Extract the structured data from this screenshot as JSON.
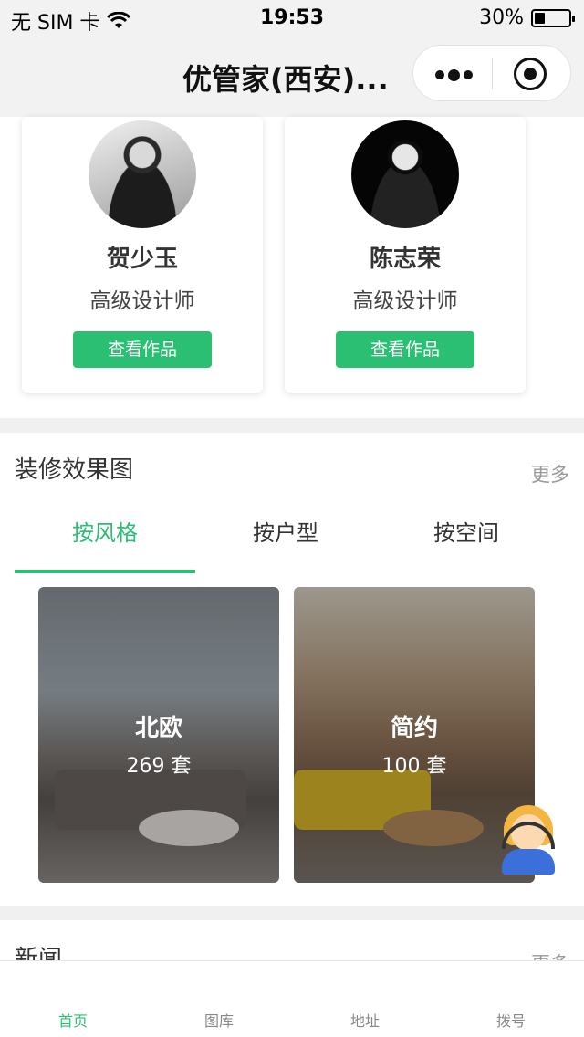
{
  "status_bar": {
    "carrier": "无 SIM 卡",
    "time": "19:53",
    "battery_text": "30%",
    "battery_level": 0.3
  },
  "nav": {
    "title": "优管家(西安)..."
  },
  "designers": [
    {
      "name": "贺少玉",
      "title": "高级设计师",
      "button": "查看作品"
    },
    {
      "name": "陈志荣",
      "title": "高级设计师",
      "button": "查看作品"
    }
  ],
  "gallery": {
    "title": "装修效果图",
    "more": "更多",
    "tabs": [
      "按风格",
      "按户型",
      "按空间"
    ],
    "active_tab": 0,
    "styles": [
      {
        "name": "北欧",
        "count": "269 套"
      },
      {
        "name": "简约",
        "count": "100 套"
      }
    ]
  },
  "news": {
    "title": "新闻",
    "more": "更多"
  },
  "tabbar": {
    "items": [
      "首页",
      "图库",
      "地址",
      "拨号"
    ],
    "active": 0
  },
  "colors": {
    "accent": "#2bbf74"
  },
  "icons": {
    "wifi": "wifi-icon",
    "menu": "more-dots-icon",
    "close": "close-target-icon",
    "agent": "customer-service-icon"
  }
}
